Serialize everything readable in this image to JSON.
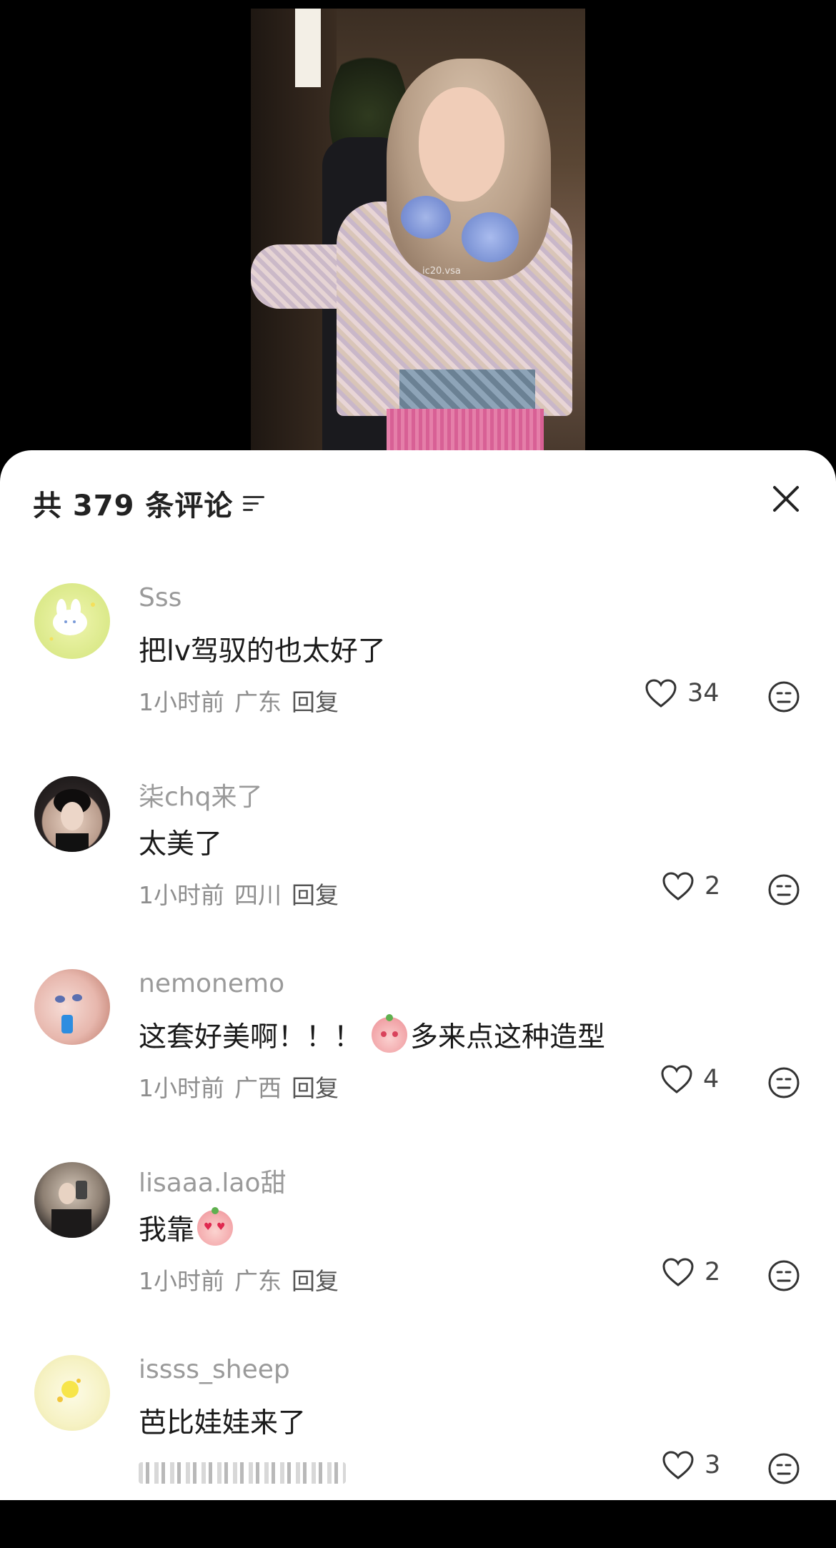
{
  "video": {
    "watermark": "ic20.vsa"
  },
  "sheet": {
    "title": "共 379 条评论"
  },
  "comments": [
    {
      "username": "Sss",
      "text": "把lv驾驭的也太好了",
      "time": "1小时前",
      "location": "广东",
      "reply_label": "回复",
      "likes": "34"
    },
    {
      "username": "柒chq来了",
      "text": "太美了",
      "time": "1小时前",
      "location": "四川",
      "reply_label": "回复",
      "likes": "2"
    },
    {
      "username": "nemonemo",
      "text_before": "这套好美啊！！！",
      "text_after": "多来点这种造型",
      "time": "1小时前",
      "location": "广西",
      "reply_label": "回复",
      "likes": "4"
    },
    {
      "username": "lisaaa.lao甜",
      "text": "我靠",
      "time": "1小时前",
      "location": "广东",
      "reply_label": "回复",
      "likes": "2"
    },
    {
      "username": "issss_sheep",
      "text": "芭比娃娃来了",
      "likes": "3"
    }
  ],
  "colors": {
    "sheet_bg": "#ffffff",
    "username": "#9a9a9a",
    "text": "#1a1a1a",
    "meta": "#8e8e8e"
  }
}
